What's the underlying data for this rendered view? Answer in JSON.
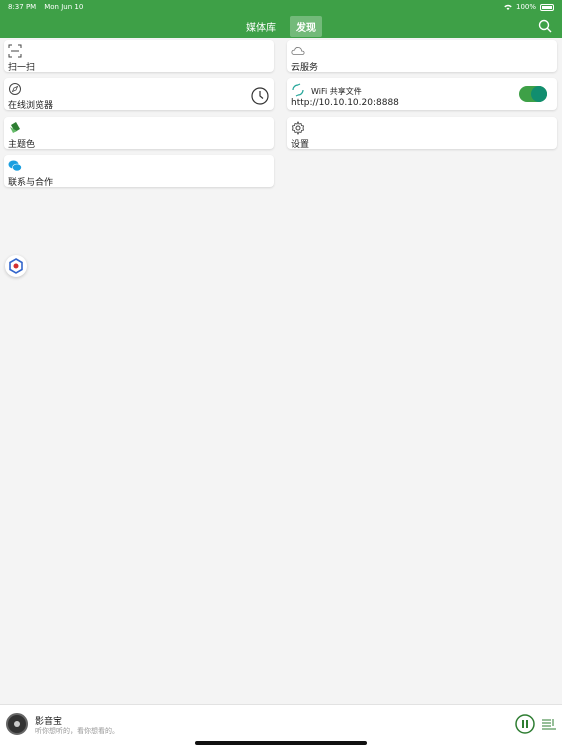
{
  "status_bar": {
    "time": "8:37 PM",
    "date": "Mon Jun 10",
    "battery": "100%"
  },
  "nav": {
    "tabs": [
      {
        "label": "媒体库",
        "active": false
      },
      {
        "label": "发现",
        "active": true
      }
    ]
  },
  "cards": {
    "scan": {
      "label": "扫一扫",
      "icon": "scan-icon"
    },
    "browser": {
      "label": "在线浏览器",
      "icon": "compass-icon"
    },
    "theme": {
      "label": "主题色",
      "icon": "theme-color-icon"
    },
    "contact": {
      "label": "联系与合作",
      "icon": "wechat-icon"
    },
    "cloud": {
      "label": "云服务",
      "icon": "cloud-icon"
    },
    "wifi": {
      "title": "WiFi 共享文件",
      "url": "http://10.10.10.20:8888",
      "enabled": true,
      "icon": "wifi-share-icon"
    },
    "settings": {
      "label": "设置",
      "icon": "gear-icon"
    }
  },
  "player": {
    "title": "影音宝",
    "subtitle": "听你想听的，看你想看的。"
  },
  "colors": {
    "accent": "#3ea047",
    "toggle_knob": "#118e6f",
    "background": "#f4f4f4"
  }
}
